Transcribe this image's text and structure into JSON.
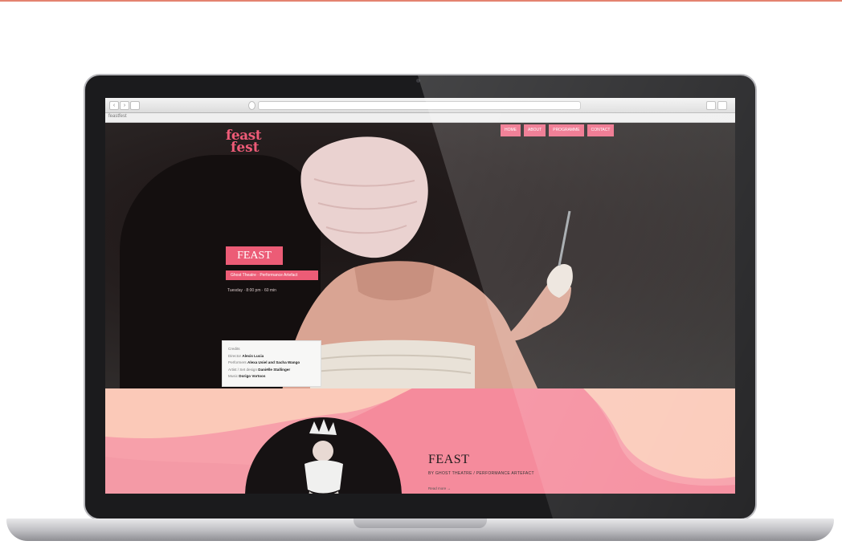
{
  "browser": {
    "back_glyph": "‹",
    "forward_glyph": "›",
    "status_text": "feastfest"
  },
  "site": {
    "logo_line1": "feast",
    "logo_line2": "fest",
    "nav": [
      "HOME",
      "ABOUT",
      "PROGRAMME",
      "CONTACT"
    ]
  },
  "hero": {
    "title": "FEAST",
    "subtitle": "Ghost Theatre · Performance Artefact",
    "meta": "Tuesday · 8:00 pm · 60 min",
    "credits_heading": "Credits",
    "credits": [
      {
        "role": "Director",
        "name": "Alexis Lucia"
      },
      {
        "role": "Performers",
        "name": "Alexa Usiel and Sacha Wango"
      },
      {
        "role": "Artist / Set design",
        "name": "Daniëlle Stallinger"
      },
      {
        "role": "Music",
        "name": "Dorigo Vortoos"
      }
    ]
  },
  "feature": {
    "title": "FEAST",
    "subtitle": "BY GHOST THEATRE / PERFORMANCE ARTEFACT",
    "extra": "Read more →"
  },
  "colors": {
    "accent": "#ec5c76",
    "pink_light": "#fbc9b8",
    "pink_mid": "#f7a0aa",
    "pink_strong": "#f58b9c",
    "hero_bg": "#2e2d2e",
    "top_rule": "#e3826f"
  },
  "icons": {
    "back": "chevron-left-icon",
    "forward": "chevron-right-icon",
    "camera": "camera-icon"
  }
}
